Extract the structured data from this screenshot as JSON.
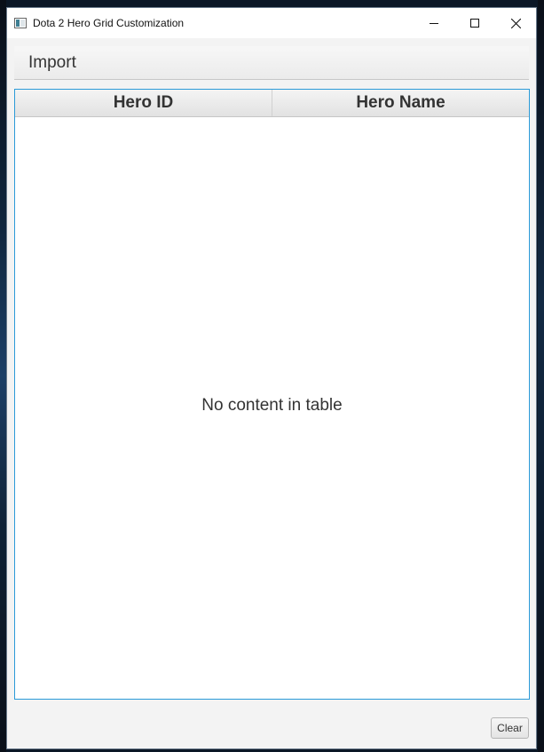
{
  "window": {
    "title": "Dota 2 Hero Grid Customization",
    "icon": "app-window-icon",
    "caption_buttons": [
      "minimize-icon",
      "maximize-icon",
      "close-icon"
    ]
  },
  "menubar": {
    "items": [
      {
        "label": "Import"
      }
    ]
  },
  "table": {
    "columns": [
      {
        "label": "Hero ID"
      },
      {
        "label": "Hero Name"
      }
    ],
    "rows": [],
    "placeholder": "No content in table"
  },
  "footer": {
    "clear_label": "Clear"
  },
  "colors": {
    "table_border": "#2a9ad8",
    "window_bg": "#f3f3f3",
    "titlebar_bg": "#ffffff"
  }
}
